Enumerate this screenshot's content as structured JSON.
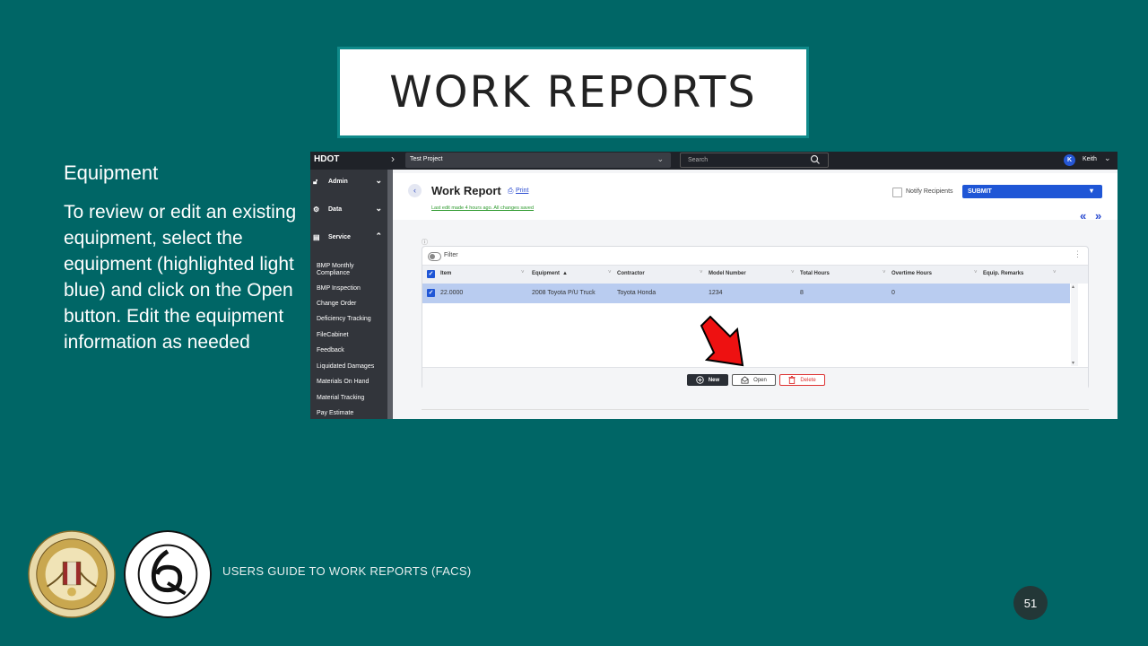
{
  "slide": {
    "title": "WORK REPORTS",
    "left_heading": "Equipment",
    "left_body": "To review or edit an existing equipment, select the equipment (highlighted light blue) and click on the Open button.  Edit the equipment information as needed",
    "footer": "USERS GUIDE TO WORK REPORTS  (FACS)",
    "page_number": "51"
  },
  "app": {
    "brand": "HDOT",
    "project": "Test Project",
    "search_placeholder": "Search",
    "user_initial": "K",
    "user_name": "Keith",
    "sidebar": {
      "sections": [
        "Admin",
        "Data",
        "Service"
      ],
      "items": [
        "BMP Monthly Compliance",
        "BMP Inspection",
        "Change Order",
        "Deficiency Tracking",
        "FileCabinet",
        "Feedback",
        "Liquidated Damages",
        "Materials On Hand",
        "Material Tracking",
        "Pay Estimate"
      ]
    },
    "header": {
      "title": "Work Report",
      "print": "Print",
      "saved_note": "Last edit made 4 hours ago. All changes saved",
      "notify_label": "Notify Recipients",
      "submit_label": "SUBMIT"
    },
    "grid": {
      "filter_label": "Filter",
      "columns": [
        "Item",
        "Equipment",
        "Contractor",
        "Model Number",
        "Total Hours",
        "Overtime Hours",
        "Equip. Remarks"
      ],
      "rows": [
        {
          "item": "22.0000",
          "equipment": "2008 Toyota P/U Truck",
          "contractor": "Toyota Honda",
          "model_number": "1234",
          "total_hours": "8",
          "overtime_hours": "0",
          "remarks": ""
        }
      ],
      "buttons": {
        "new": "New",
        "open": "Open",
        "delete": "Delete"
      }
    }
  },
  "colors": {
    "background": "#006666",
    "accent": "#1f56d6",
    "selected_row": "#b9ccf0",
    "arrow": "#ee1111"
  }
}
